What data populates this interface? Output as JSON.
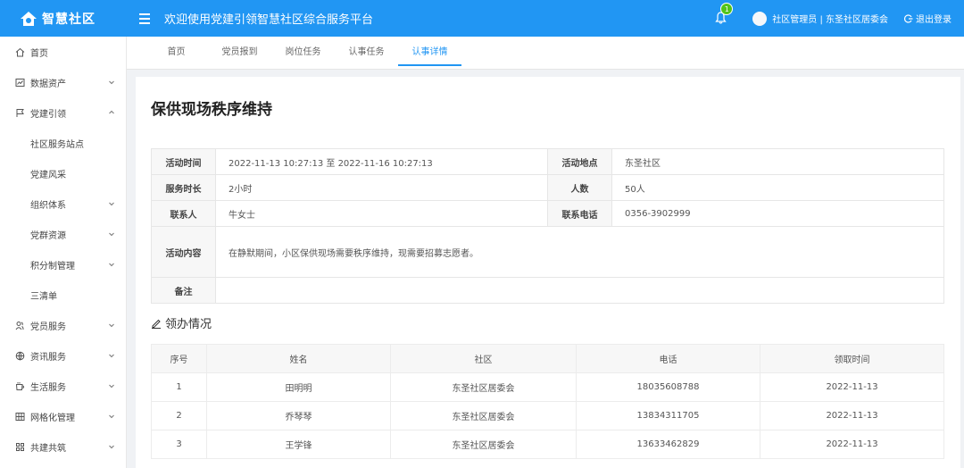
{
  "app": {
    "logo_text": "智慧社区",
    "welcome": "欢迎使用党建引领智慧社区综合服务平台"
  },
  "header": {
    "notification_count": "1",
    "user": "社区管理员 | 东圣社区居委会",
    "logout": "退出登录"
  },
  "sidebar": {
    "items": [
      {
        "label": "首页",
        "icon": "home-icon"
      },
      {
        "label": "数据资产",
        "icon": "chart-icon"
      },
      {
        "label": "党建引领",
        "icon": "flag-icon"
      },
      {
        "label": "社区服务站点",
        "icon": ""
      },
      {
        "label": "党建风采",
        "icon": ""
      },
      {
        "label": "组织体系",
        "icon": ""
      },
      {
        "label": "党群资源",
        "icon": ""
      },
      {
        "label": "积分制管理",
        "icon": ""
      },
      {
        "label": "三清单",
        "icon": ""
      },
      {
        "label": "党员服务",
        "icon": "people-icon"
      },
      {
        "label": "资讯服务",
        "icon": "globe-icon"
      },
      {
        "label": "生活服务",
        "icon": "cup-icon"
      },
      {
        "label": "网格化管理",
        "icon": "grid-icon"
      },
      {
        "label": "共建共筑",
        "icon": "build-icon"
      }
    ]
  },
  "tabs": [
    "首页",
    "党员报到",
    "岗位任务",
    "认事任务",
    "认事详情"
  ],
  "detail": {
    "title": "保供现场秩序维持",
    "labels": {
      "time": "活动时间",
      "place": "活动地点",
      "duration": "服务时长",
      "people": "人数",
      "contact": "联系人",
      "phone": "联系电话",
      "content": "活动内容",
      "remark": "备注"
    },
    "values": {
      "time": "2022-11-13 10:27:13 至 2022-11-16 10:27:13",
      "place": "东圣社区",
      "duration": "2小时",
      "people": "50人",
      "contact": "牛女士",
      "phone": "0356-3902999",
      "content": "在静默期间，小区保供现场需要秩序维持，现需要招募志愿者。",
      "remark": ""
    }
  },
  "claim": {
    "section_title": "领办情况",
    "headers": [
      "序号",
      "姓名",
      "社区",
      "电话",
      "领取时间"
    ],
    "rows": [
      {
        "no": "1",
        "name": "田明明",
        "community": "东圣社区居委会",
        "phone": "18035608788",
        "date": "2022-11-13"
      },
      {
        "no": "2",
        "name": "乔琴琴",
        "community": "东圣社区居委会",
        "phone": "13834311705",
        "date": "2022-11-13"
      },
      {
        "no": "3",
        "name": "王学锋",
        "community": "东圣社区居委会",
        "phone": "13633462829",
        "date": "2022-11-13"
      }
    ]
  },
  "colors": {
    "primary": "#2196f3",
    "badge": "#52c41a"
  }
}
